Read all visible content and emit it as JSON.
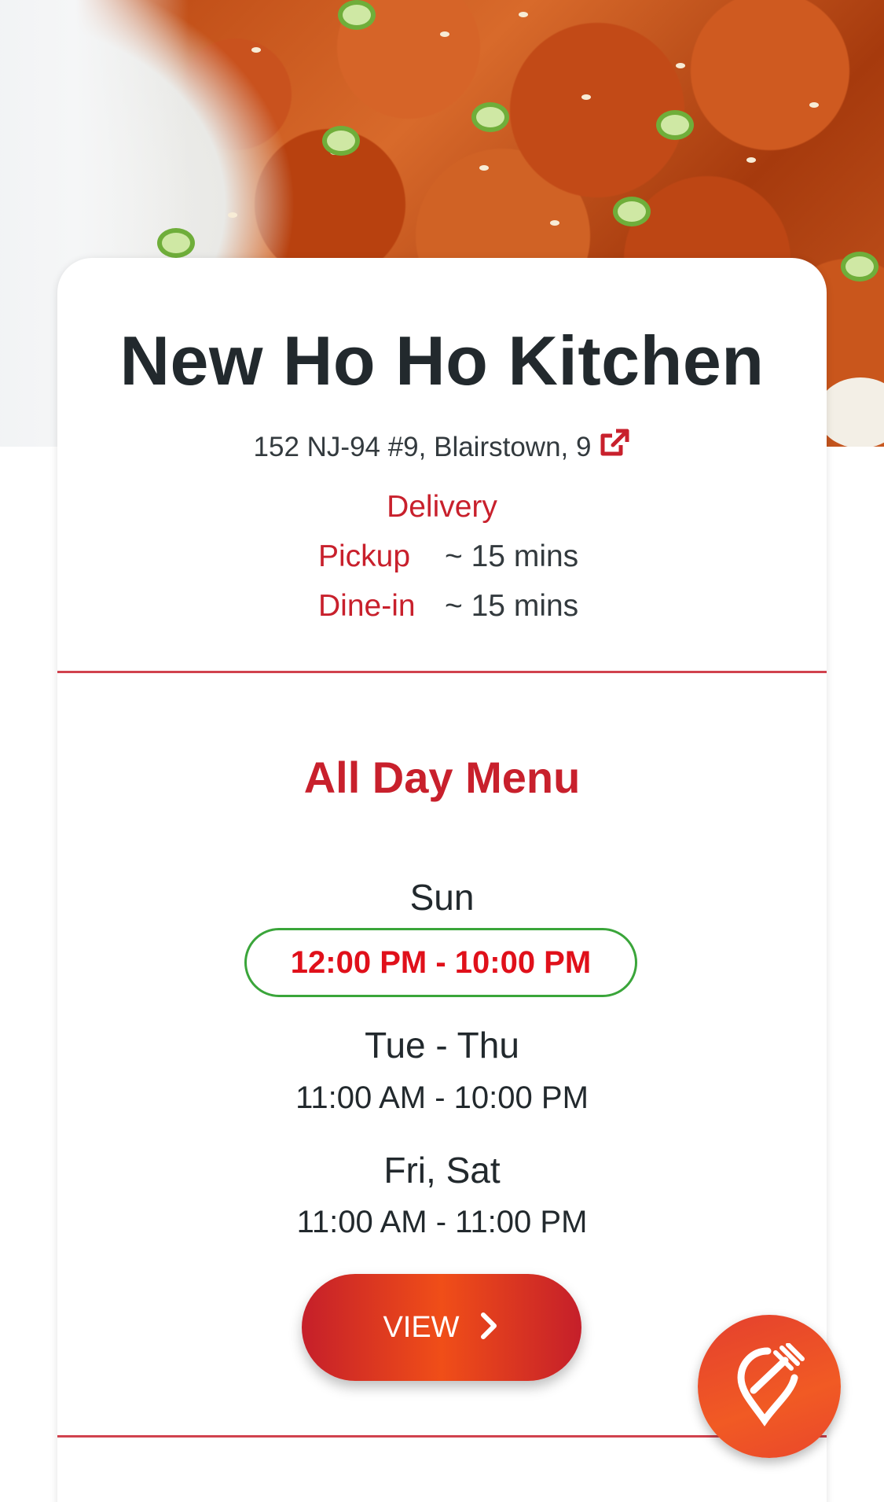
{
  "restaurant": {
    "name": "New Ho Ho Kitchen",
    "address": "152 NJ-94 #9, Blairstown, 9"
  },
  "services": {
    "delivery_label": "Delivery",
    "pickup_label": "Pickup",
    "pickup_time": "~ 15 mins",
    "dinein_label": "Dine-in",
    "dinein_time": "~ 15 mins"
  },
  "menu": {
    "title": "All Day Menu",
    "schedule": [
      {
        "days": "Sun",
        "hours": "12:00 PM - 10:00 PM",
        "current": true
      },
      {
        "days": "Tue - Thu",
        "hours": "11:00 AM - 10:00 PM",
        "current": false
      },
      {
        "days": "Fri, Sat",
        "hours": "11:00 AM - 11:00 PM",
        "current": false
      }
    ],
    "view_label": "VIEW"
  },
  "icons": {
    "address_link": "external-link-icon",
    "view_chevron": "chevron-right-icon",
    "fab": "fork-location-pin-icon"
  },
  "colors": {
    "accent_red": "#c8202c",
    "current_hours_red": "#e0101a",
    "current_border_green": "#3aa53a",
    "button_orange": "#f04e18"
  }
}
